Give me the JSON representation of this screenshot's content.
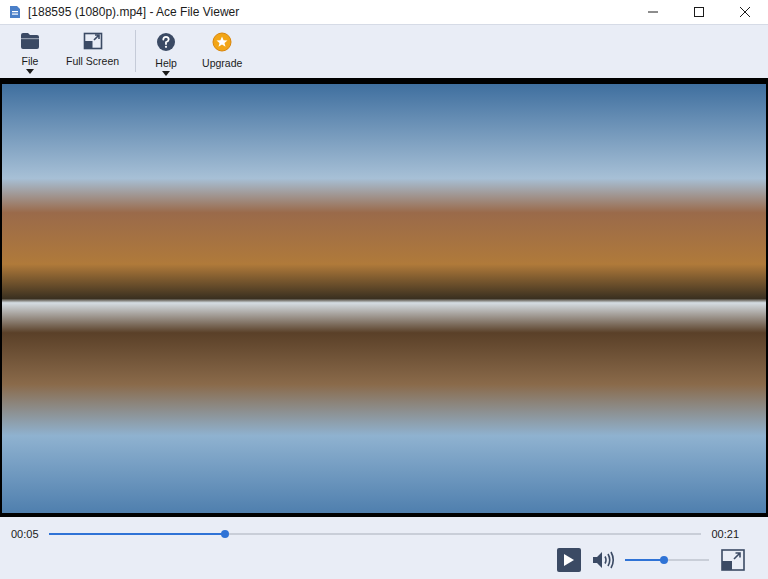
{
  "window": {
    "title": "[188595 (1080p).mp4] - Ace File Viewer"
  },
  "toolbar": [
    {
      "label": "File",
      "dropdown": true
    },
    {
      "label": "Full Screen",
      "dropdown": false
    },
    {
      "label": "Help",
      "dropdown": true
    },
    {
      "label": "Upgrade",
      "dropdown": false
    }
  ],
  "player": {
    "current_time": "00:05",
    "total_time": "00:21",
    "progress": {
      "level": 0.27
    },
    "playing": false,
    "volume": {
      "level": 0.47
    }
  }
}
